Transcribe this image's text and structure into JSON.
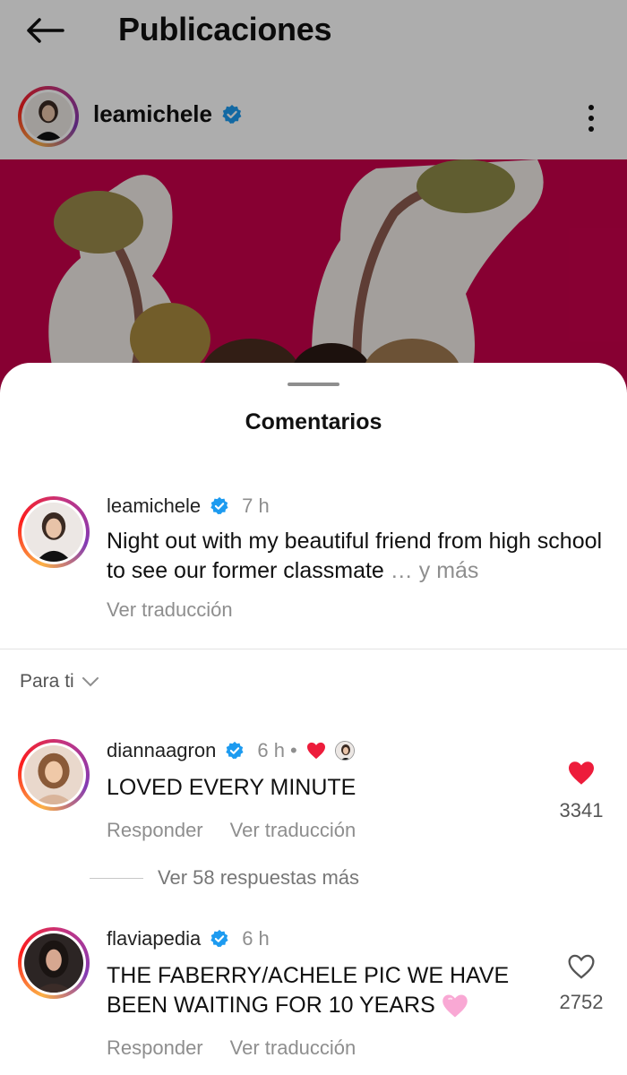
{
  "header": {
    "title": "Publicaciones",
    "back_icon": "arrow-left-icon"
  },
  "post": {
    "username": "leamichele",
    "verified": true,
    "more_icon": "more-vertical-icon",
    "photo_bg_color": "#c8004b"
  },
  "sheet": {
    "title": "Comentarios",
    "caption": {
      "username": "leamichele",
      "time": "7 h",
      "text": "Night out with my beautiful friend from high school to see our former classmate",
      "more": "… y más",
      "translate": "Ver traducción"
    },
    "sort_label": "Para ti",
    "comments": [
      {
        "username": "diannaagron",
        "time": "6 h",
        "dot": "•",
        "text": "LOVED EVERY MINUTE",
        "reply": "Responder",
        "translate": "Ver traducción",
        "likes": "3341",
        "liked": true,
        "liked_by_author": true
      },
      {
        "username": "flaviapedia",
        "time": "6 h",
        "text": "THE FABERRY/ACHELE PIC WE HAVE BEEN WAITING FOR 10 YEARS",
        "reply": "Responder",
        "translate": "Ver traducción",
        "likes": "2752",
        "liked": false
      }
    ],
    "view_replies": "Ver 58 respuestas más"
  },
  "colors": {
    "accent_blue": "#1d9bf0",
    "heart_red": "#ed1c3b",
    "muted": "#8e8e8e"
  }
}
